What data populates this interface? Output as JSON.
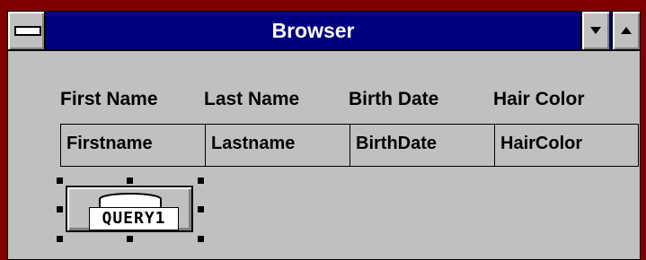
{
  "window": {
    "title": "Browser"
  },
  "columns": [
    {
      "header": "First Name",
      "field": "Firstname"
    },
    {
      "header": "Last Name",
      "field": "Lastname"
    },
    {
      "header": "Birth Date",
      "field": "BirthDate"
    },
    {
      "header": "Hair Color",
      "field": "HairColor"
    }
  ],
  "query_control": {
    "label": "QUERY1"
  },
  "colors": {
    "titlebar": "#000080",
    "face": "#c0c0c0",
    "frame": "#800000"
  },
  "icons": {
    "system_menu": "system-menu-icon",
    "minimize": "down-arrow-icon",
    "maximize": "up-arrow-icon",
    "query": "query-icon"
  }
}
